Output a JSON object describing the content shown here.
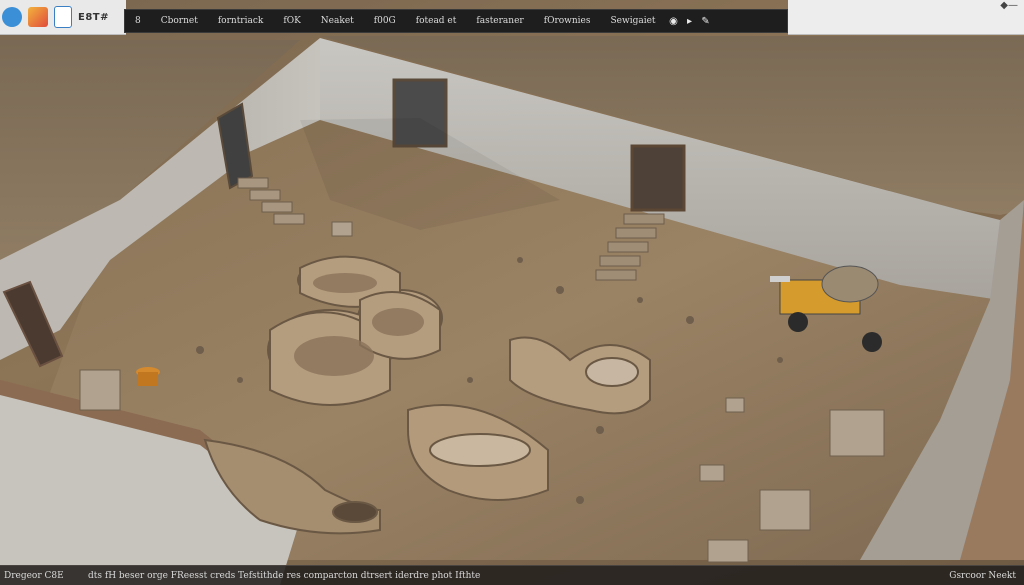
{
  "app": {
    "title": "E8T#"
  },
  "toolbar": {
    "items": [
      {
        "label": "8"
      },
      {
        "label": "Cbornet"
      },
      {
        "label": "forntriack"
      },
      {
        "label": "fOK"
      },
      {
        "label": "Neaket"
      },
      {
        "label": "f00G"
      },
      {
        "label": "fotead et"
      },
      {
        "label": "fasteraner"
      },
      {
        "label": "fOrownies"
      },
      {
        "label": "Sewigaiet"
      }
    ],
    "icons": [
      "eye-icon",
      "play-icon",
      "pen-icon"
    ]
  },
  "status": {
    "left": "Dregeor C8E",
    "middle": "dts fH beser orge FReesst creds  Tefstithde res  comparcton dtrsert  iderdre phot  Ifthte",
    "right": "Gsrcoor  Neekt"
  },
  "colors": {
    "toolbar_bg": "#1e1e1e",
    "ground": "#8c7456",
    "wall": "#b9b7b2"
  }
}
